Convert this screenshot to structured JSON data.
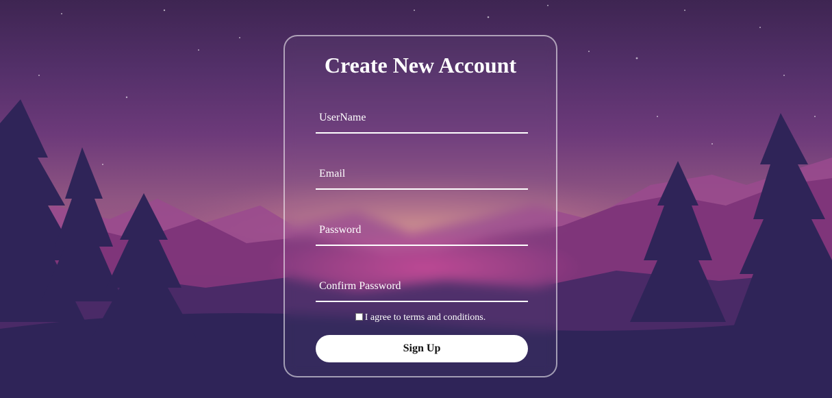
{
  "form": {
    "title": "Create New Account",
    "fields": [
      {
        "placeholder": "UserName",
        "value": ""
      },
      {
        "placeholder": "Email",
        "value": ""
      },
      {
        "placeholder": "Password",
        "value": ""
      },
      {
        "placeholder": "Confirm Password",
        "value": ""
      }
    ],
    "agree_label": "I agree to terms and conditions.",
    "agree_checked": false,
    "submit_label": "Sign Up"
  },
  "colors": {
    "sky_top": "#3e2552",
    "glow": "#c98a8a",
    "mountain": "#8a3a7f",
    "trees": "#2f2458",
    "text": "#ffffff",
    "button_bg": "#ffffff"
  }
}
